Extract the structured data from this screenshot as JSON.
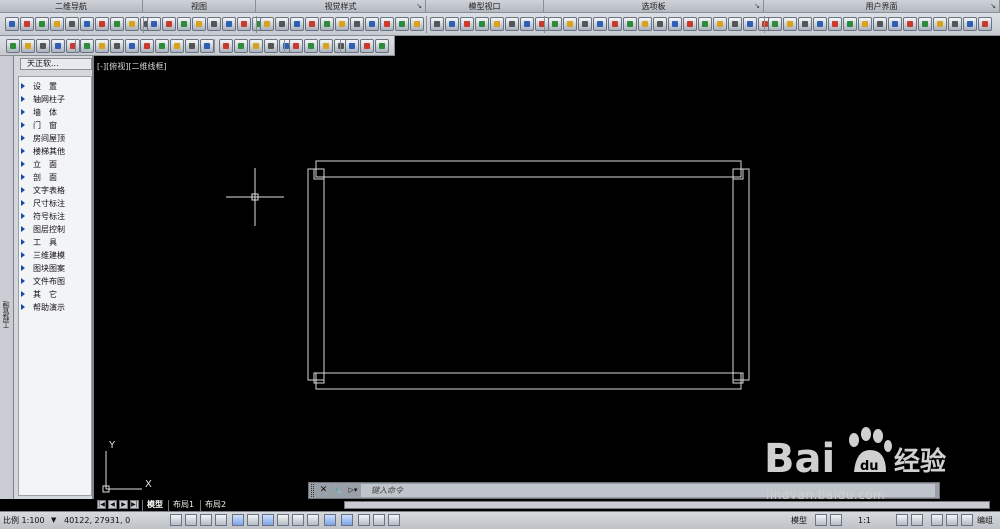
{
  "ribbon_panels": [
    {
      "title": "二维导航",
      "width": 143
    },
    {
      "title": "视图",
      "width": 113
    },
    {
      "title": "视觉样式",
      "width": 170
    },
    {
      "title": "模型视口",
      "width": 118
    },
    {
      "title": "选项板",
      "width": 220
    },
    {
      "title": "用户界面",
      "width": 236
    }
  ],
  "sidebar": {
    "strip_label": "工程管理",
    "title": "天正软...",
    "items": [
      "设　置",
      "轴网柱子",
      "墙　体",
      "门　窗",
      "房间屋顶",
      "楼梯其他",
      "立　面",
      "剖　面",
      "文字表格",
      "尺寸标注",
      "符号标注",
      "图层控制",
      "工　具",
      "三维建模",
      "图块图案",
      "文件布图",
      "其　它",
      "帮助演示"
    ]
  },
  "viewport": {
    "label": "[-][俯视][二维线框]",
    "ucs_x": "X",
    "ucs_y": "Y"
  },
  "command_line": {
    "placeholder": "键入命令",
    "close_icon": "✕",
    "wrench_icon": "🔧",
    "prompt_icon": "▷▾"
  },
  "layout_tabs": [
    "模型",
    "布局1",
    "布局2"
  ],
  "status_bar": {
    "scale": "比例 1:100",
    "coordinates": "40122, 27931, 0",
    "model_label": "模型",
    "annotation_scale": "1:1",
    "workspace_label": "编组"
  },
  "watermark": {
    "brand": "Bai",
    "brand_sub": "经验",
    "url": "jingyan.baidu.com"
  },
  "colors": {
    "canvas": "#000000",
    "lines": "#d9d9d9",
    "accent": "#1a4aa8"
  }
}
